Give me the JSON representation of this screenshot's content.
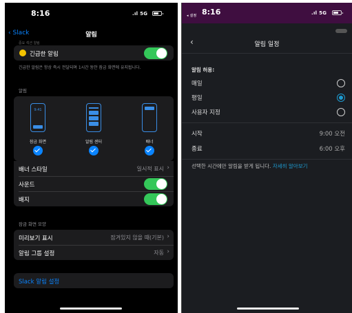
{
  "left": {
    "status": {
      "time": "8:16",
      "signal": "5G"
    },
    "nav": {
      "back": "Slack",
      "title": "알림"
    },
    "cut_header": "중요 섹션 알림",
    "urgent": {
      "label": "긴급한 알림",
      "note": "긴급한 알림은 항상 즉시 전달되며 1시간 동안 잠금 화면에 유지됩니다.",
      "on": true
    },
    "alerts_header": "알림",
    "previews": [
      {
        "label": "잠금 화면",
        "clock": "9:41"
      },
      {
        "label": "알림 센터"
      },
      {
        "label": "배너"
      }
    ],
    "banner_style": {
      "label": "배너 스타일",
      "value": "일시적 표시"
    },
    "sound": {
      "label": "사운드",
      "on": true
    },
    "badge": {
      "label": "배지",
      "on": true
    },
    "lock_header": "잠금 화면 모양",
    "preview_show": {
      "label": "미리보기 표시",
      "value": "잠겨있지 않을 때(기본)"
    },
    "grouping": {
      "label": "알림 그룹 설정",
      "value": "자동"
    },
    "slack_settings": "Slack 알림 설정"
  },
  "right": {
    "status": {
      "time": "8:16",
      "back_app": "◂ 설정",
      "signal": "5G"
    },
    "title": "알림 일정",
    "allow_header": "알림 허용:",
    "options": [
      {
        "label": "매일",
        "selected": false
      },
      {
        "label": "평일",
        "selected": true
      },
      {
        "label": "사용자 지정",
        "selected": false
      }
    ],
    "start": {
      "label": "시작",
      "value": "9:00 오전"
    },
    "end": {
      "label": "종료",
      "value": "6:00 오후"
    },
    "note": "선택한 시간에만 알림을 받게 됩니다. ",
    "note_link": "자세히 알아보기"
  },
  "colors": {
    "accent": "#0a84ff",
    "toggle_on": "#34c759",
    "slack_blue": "#1d9bd1",
    "header_purple": "#3f0e40"
  }
}
